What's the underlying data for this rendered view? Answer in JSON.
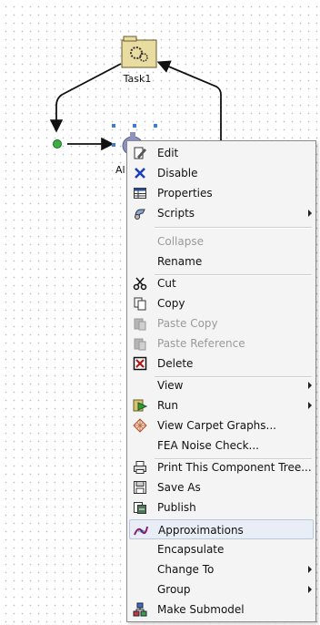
{
  "canvas": {
    "task_label": "Task1",
    "partial_node_label": "Al"
  },
  "context_menu": {
    "items": [
      {
        "label": "Edit",
        "icon": "edit-icon",
        "enabled": true
      },
      {
        "label": "Disable",
        "icon": "disable-x-icon",
        "enabled": true
      },
      {
        "label": "Properties",
        "icon": "properties-table-icon",
        "enabled": true
      },
      {
        "label": "Scripts",
        "icon": "scripts-icon",
        "enabled": true,
        "submenu": true
      },
      {
        "label": "Collapse",
        "enabled": false
      },
      {
        "label": "Rename",
        "enabled": true
      },
      {
        "label": "Cut",
        "icon": "scissors-icon",
        "enabled": true
      },
      {
        "label": "Copy",
        "icon": "copy-icon",
        "enabled": true
      },
      {
        "label": "Paste Copy",
        "icon": "paste-icon",
        "enabled": false
      },
      {
        "label": "Paste Reference",
        "icon": "paste-reference-icon",
        "enabled": false
      },
      {
        "label": "Delete",
        "icon": "delete-icon",
        "enabled": true
      },
      {
        "label": "View",
        "enabled": true,
        "submenu": true
      },
      {
        "label": "Run",
        "icon": "run-icon",
        "enabled": true,
        "submenu": true
      },
      {
        "label": "View Carpet Graphs...",
        "icon": "carpet-graph-icon",
        "enabled": true
      },
      {
        "label": "FEA Noise Check...",
        "enabled": true
      },
      {
        "label": "Print This Component Tree...",
        "icon": "printer-icon",
        "enabled": true
      },
      {
        "label": "Save As",
        "icon": "save-icon",
        "enabled": true
      },
      {
        "label": "Publish",
        "icon": "publish-icon",
        "enabled": true
      },
      {
        "label": "Approximations",
        "icon": "approximations-icon",
        "enabled": true,
        "highlighted": true
      },
      {
        "label": "Encapsulate",
        "enabled": true
      },
      {
        "label": "Change To",
        "enabled": true,
        "submenu": true
      },
      {
        "label": "Group",
        "enabled": true,
        "submenu": true
      },
      {
        "label": "Make Submodel",
        "icon": "submodel-icon",
        "enabled": true
      }
    ]
  },
  "colors": {
    "menu_background": "#f4f4f4",
    "highlight": "#e9eef6",
    "disabled_text": "#9a9a9a",
    "task_folder": "#e8dca0",
    "start_node": "#3cb043",
    "selection_handles": "#3a7fd0"
  }
}
